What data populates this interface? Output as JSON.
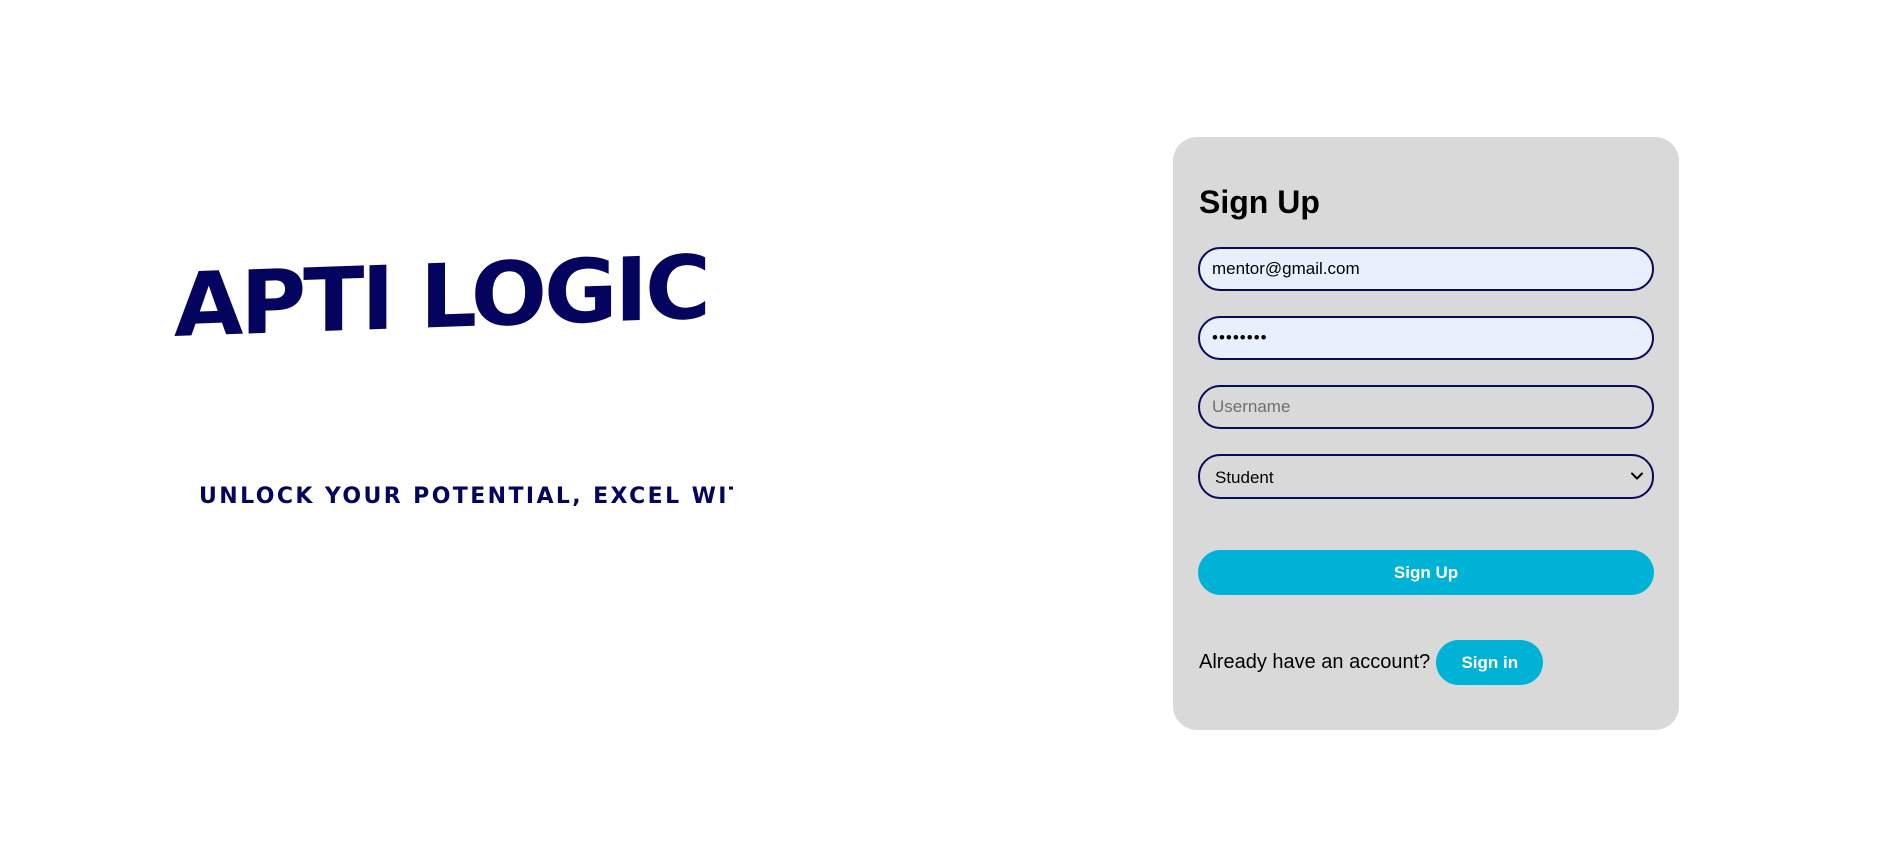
{
  "hero": {
    "logo_text": "APTI LOGIC",
    "tagline": "Unlock Your Potential, Excel With Apti Logic",
    "colors": {
      "brand": "#04045e"
    }
  },
  "signup_form": {
    "title": "Sign Up",
    "email_value": "mentor@gmail.com",
    "password_value": "••••••••",
    "username_placeholder": "Username",
    "role_selected": "Student",
    "submit_label": "Sign Up",
    "account_prompt": "Already have an account?",
    "signin_label": "Sign in",
    "colors": {
      "card_background": "#d9d9d9",
      "accent": "#00b2d6",
      "field_border": "#0a0a5a",
      "autofill_background": "#e8f0fe"
    }
  }
}
